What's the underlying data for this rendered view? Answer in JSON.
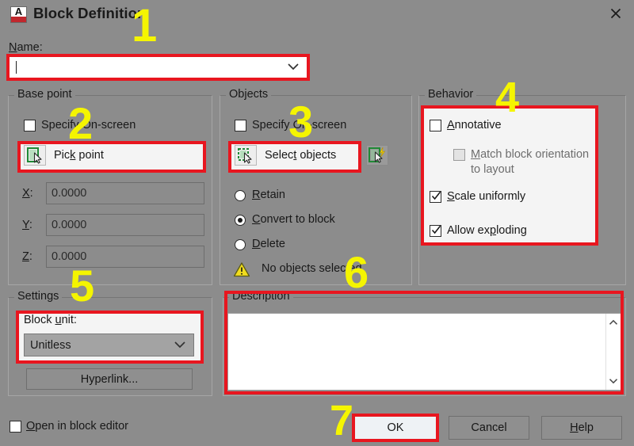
{
  "window": {
    "title": "Block Definition",
    "icon": "autocad-a-icon",
    "close_label": "✕"
  },
  "name_field": {
    "label": "Name:",
    "label_accel": "N",
    "value": "",
    "placeholder": ""
  },
  "base_point": {
    "group_title": "Base point",
    "specify_on_screen": {
      "label": "Specify On-screen",
      "checked": false
    },
    "pick_point": {
      "label": "Pick point",
      "accel": "k",
      "icon": "pick-point-icon"
    },
    "coords": [
      {
        "label": "X:",
        "accel": "X",
        "value": "0.0000"
      },
      {
        "label": "Y:",
        "accel": "Y",
        "value": "0.0000"
      },
      {
        "label": "Z:",
        "accel": "Z",
        "value": "0.0000"
      }
    ]
  },
  "objects": {
    "group_title": "Objects",
    "specify_on_screen": {
      "label": "Specify On-screen",
      "checked": false
    },
    "select_objects": {
      "label": "Select objects",
      "accel": "t",
      "icon": "select-objects-icon"
    },
    "quick_select": {
      "icon": "quick-select-icon"
    },
    "radios": [
      {
        "label": "Retain",
        "accel": "R",
        "selected": false
      },
      {
        "label": "Convert to block",
        "accel": "C",
        "selected": true
      },
      {
        "label": "Delete",
        "accel": "D",
        "selected": false
      }
    ],
    "status": {
      "icon": "warning-icon",
      "text": "No objects selected"
    }
  },
  "behavior": {
    "group_title": "Behavior",
    "options": [
      {
        "label": "Annotative",
        "accel": "A",
        "checked": false,
        "disabled": false,
        "indent": 0
      },
      {
        "label": "Match block orientation to layout",
        "accel": "M",
        "checked": false,
        "disabled": true,
        "indent": 1
      },
      {
        "label": "Scale uniformly",
        "accel": "S",
        "checked": true,
        "disabled": false,
        "indent": 0
      },
      {
        "label": "Allow exploding",
        "accel": "p",
        "checked": true,
        "disabled": false,
        "indent": 0
      }
    ]
  },
  "settings": {
    "group_title": "Settings",
    "block_unit": {
      "label": "Block unit:",
      "accel": "u",
      "value": "Unitless"
    },
    "hyperlink_button": {
      "label": "Hyperlink..."
    }
  },
  "description": {
    "group_title": "Description",
    "value": ""
  },
  "footer": {
    "open_in_block_editor": {
      "label": "Open in block editor",
      "accel": "O",
      "checked": false
    },
    "buttons": [
      {
        "label": "OK",
        "default": true
      },
      {
        "label": "Cancel",
        "default": false
      },
      {
        "label": "Help",
        "accel": "H",
        "default": false
      }
    ]
  },
  "annotations": {
    "accent_color": "#e8161f",
    "number_color": "#f5f500",
    "steps": [
      {
        "number": "1",
        "target": "name-combobox"
      },
      {
        "number": "2",
        "target": "pick-point-button"
      },
      {
        "number": "3",
        "target": "select-objects-button"
      },
      {
        "number": "4",
        "target": "behavior-options"
      },
      {
        "number": "5",
        "target": "block-unit-combobox"
      },
      {
        "number": "6",
        "target": "description-area"
      },
      {
        "number": "7",
        "target": "ok-button"
      }
    ]
  }
}
